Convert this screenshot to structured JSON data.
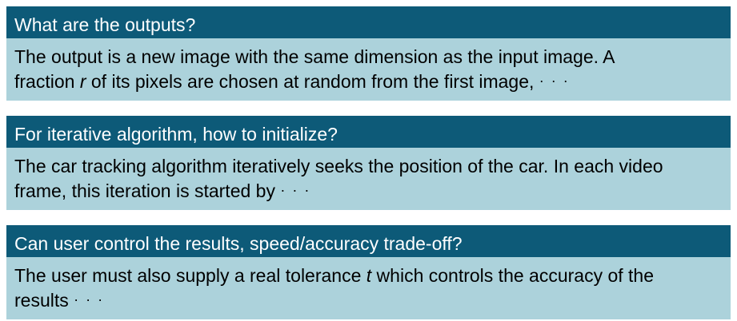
{
  "blocks": [
    {
      "title": "What are the outputs?",
      "line1": "The output is a new image with the same dimension as the input image. A",
      "line2_pre": "fraction ",
      "line2_var": "r",
      "line2_post": " of its pixels are chosen at random from the first image, ",
      "ellipsis": "· · ·"
    },
    {
      "title": "For iterative algorithm, how to initialize?",
      "line1": "The car tracking algorithm iteratively seeks the position of the car. In each video",
      "line2_pre": "frame, this iteration is started by ",
      "ellipsis": "· · ·"
    },
    {
      "title": "Can user control the results, speed/accuracy trade-off?",
      "line1_pre": "The user must also supply a real tolerance ",
      "line1_var": "t",
      "line1_post": " which controls the accuracy of the",
      "line2_pre": "results ",
      "ellipsis": "· · ·"
    }
  ]
}
